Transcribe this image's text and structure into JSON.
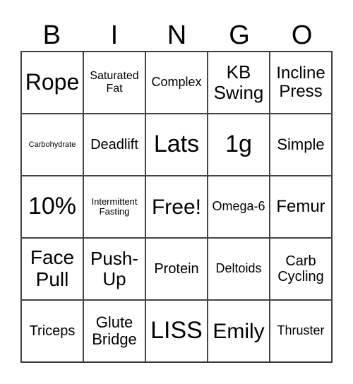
{
  "header": [
    "B",
    "I",
    "N",
    "G",
    "O"
  ],
  "cells": [
    "Rope",
    "Saturated Fat",
    "Complex",
    "KB Swing",
    "Incline Press",
    "Carbohydrate",
    "Deadlift",
    "Lats",
    "1g",
    "Simple",
    "10%",
    "Intermittent Fasting",
    "Free!",
    "Omega-6",
    "Femur",
    "Face Pull",
    "Push-Up",
    "Protein",
    "Deltoids",
    "Carb Cycling",
    "Triceps",
    "Glute Bridge",
    "LISS",
    "Emily",
    "Thruster"
  ]
}
